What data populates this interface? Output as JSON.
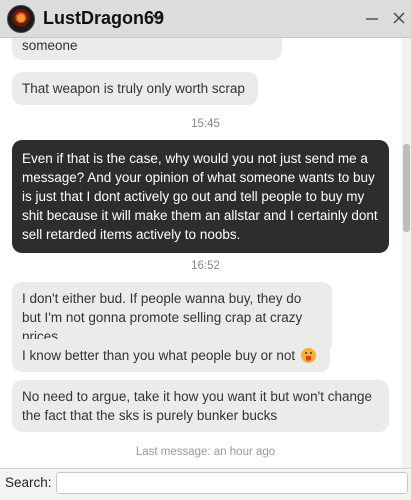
{
  "header": {
    "username": "LustDragon69",
    "avatar_icon": "dragon-avatar-icon",
    "dropdown_icon": "chevron-down-icon",
    "minimize_icon": "minimize-icon",
    "close_icon": "close-icon"
  },
  "messages": [
    {
      "type": "in",
      "text": "someone"
    },
    {
      "type": "in",
      "text": "That weapon is truly only worth scrap"
    },
    {
      "type": "timestamp",
      "text": "15:45"
    },
    {
      "type": "out",
      "text": "Even if that is the case, why would you not just send me a message? And your opinion of what someone wants to buy is just that I dont actively go out and tell people to buy my shit because it will make them an allstar and I certainly dont sell retarded items actively to noobs."
    },
    {
      "type": "timestamp",
      "text": "16:52"
    },
    {
      "type": "in",
      "text": "I don't either bud. If people wanna buy, they do but I'm not gonna promote selling crap at crazy prices"
    },
    {
      "type": "in",
      "text": "I know better than you what people buy or not",
      "emoji": "tongue-out-emoji"
    },
    {
      "type": "in",
      "text": "No need to argue, take it how you want it but won't change the fact that the sks is purely bunker bucks"
    }
  ],
  "footer": {
    "last_message": "Last message: an hour ago",
    "search_label": "Search:",
    "search_value": "",
    "search_placeholder": ""
  }
}
